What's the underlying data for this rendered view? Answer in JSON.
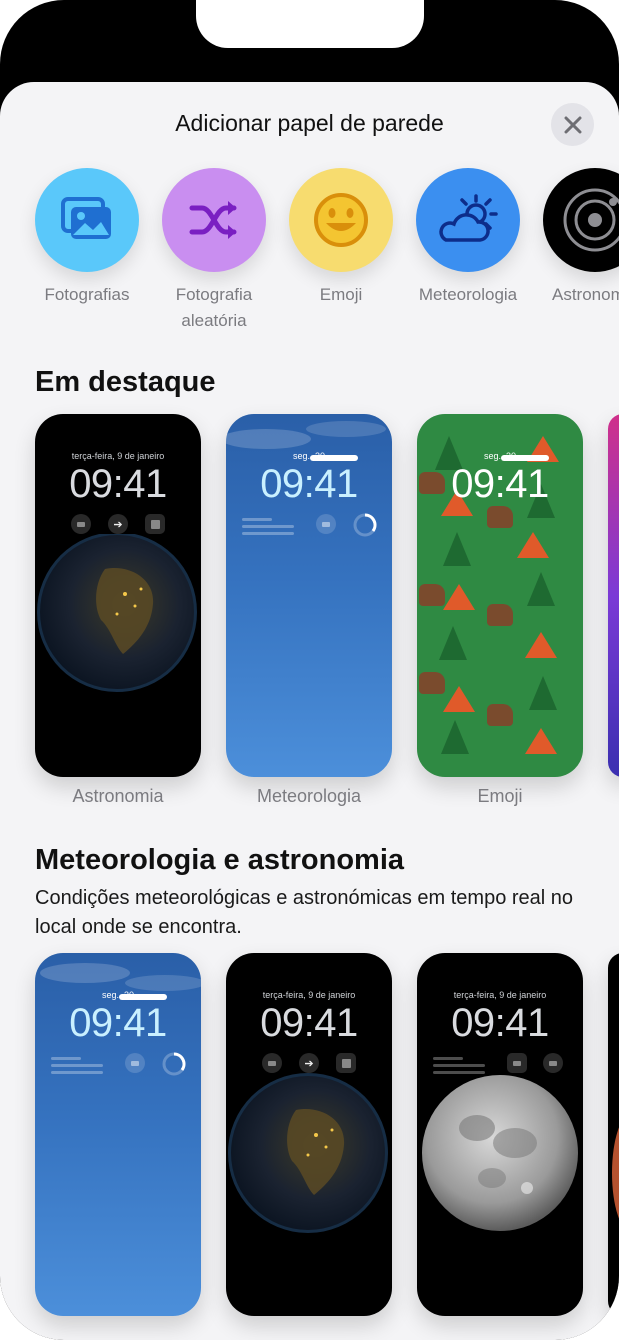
{
  "sheet": {
    "title": "Adicionar papel de parede"
  },
  "categories": [
    {
      "label": "Fotografias",
      "icon": "photos-icon",
      "color": "#5ac8fa"
    },
    {
      "label": "Fotografia\naleatória",
      "label_line1": "Fotografia",
      "label_line2": "aleatória",
      "icon": "shuffle-icon",
      "color": "#c98ef0"
    },
    {
      "label": "Emoji",
      "icon": "emoji-icon",
      "color": "#f7dc6f"
    },
    {
      "label": "Meteorologia",
      "icon": "weather-icon",
      "color": "#3b8ff0"
    },
    {
      "label": "Astronomia",
      "icon": "astronomy-icon",
      "color": "#000000"
    }
  ],
  "featured": {
    "title": "Em destaque",
    "cards": [
      {
        "label": "Astronomia",
        "date": "terça-feira, 9 de janeiro",
        "time": "09:41"
      },
      {
        "label": "Meteorologia",
        "date": "seg., 30",
        "time": "09:41"
      },
      {
        "label": "Emoji",
        "date": "seg., 30",
        "time": "09:41"
      }
    ]
  },
  "weather_astro": {
    "title": "Meteorologia e astronomia",
    "description": "Condições meteorológicas e astronómicas em tempo real no local onde se encontra.",
    "cards": [
      {
        "date": "seg., 30",
        "time": "09:41"
      },
      {
        "date": "terça-feira, 9 de janeiro",
        "time": "09:41"
      },
      {
        "date": "terça-feira, 9 de janeiro",
        "time": "09:41"
      }
    ]
  }
}
